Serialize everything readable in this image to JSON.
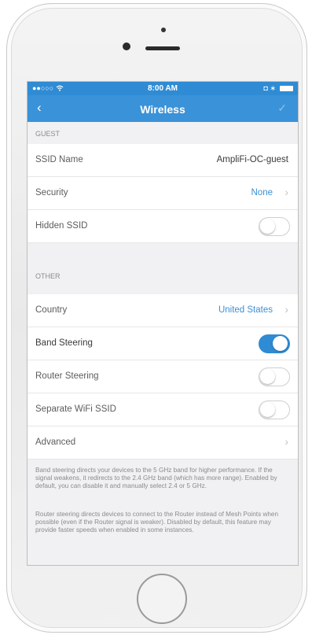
{
  "status_bar": {
    "signal": "●●○○○",
    "wifi_icon": "wifi-icon",
    "time": "8:00 AM",
    "right_icons": "◘ ∗"
  },
  "nav": {
    "back_glyph": "‹",
    "title": "Wireless",
    "done_glyph": "✓"
  },
  "guest": {
    "header": "GUEST",
    "ssid_label": "SSID Name",
    "ssid_value": "AmpliFi-OC-guest",
    "security_label": "Security",
    "security_value": "None",
    "hidden_label": "Hidden SSID",
    "hidden_on": false
  },
  "other": {
    "header": "OTHER",
    "country_label": "Country",
    "country_value": "United States",
    "band_label": "Band Steering",
    "band_on": true,
    "router_label": "Router Steering",
    "router_on": false,
    "separate_label": "Separate WiFi SSID",
    "separate_on": false,
    "advanced_label": "Advanced"
  },
  "footer": {
    "band_note": "Band steering directs your devices to the 5 GHz band for higher performance. If the signal weakens, it redirects to the 2.4 GHz band (which has more range). Enabled by default, you can disable it and manually select 2.4 or 5 GHz.",
    "router_note": "Router steering directs devices to connect to the Router instead of Mesh Points when possible (even if the Router signal is weaker). Disabled by default, this feature may provide faster speeds when enabled in some instances."
  },
  "colors": {
    "accent": "#3a92d8",
    "status_bar": "#2f8bd3",
    "background": "#f1f1f3"
  }
}
